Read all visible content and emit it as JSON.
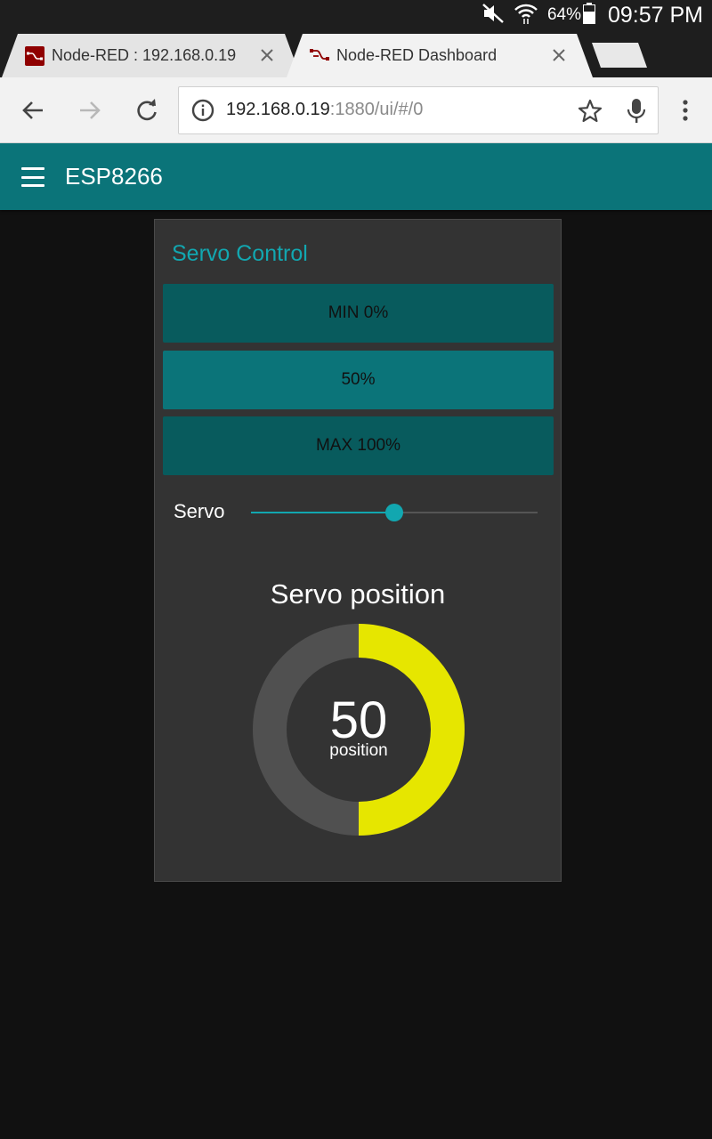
{
  "status_bar": {
    "battery_percent": "64%",
    "time": "09:57 PM",
    "icons": [
      "mute-icon",
      "wifi-icon",
      "battery-icon"
    ]
  },
  "tabs": [
    {
      "title": "Node-RED : 192.168.0.19",
      "active": false,
      "icon": "node-red-favicon"
    },
    {
      "title": "Node-RED Dashboard",
      "active": true,
      "icon": "node-red-favicon"
    }
  ],
  "toolbar": {
    "url_host": "192.168.0.19",
    "url_rest": ":1880/ui/#/0",
    "icons": [
      "back-arrow-icon",
      "forward-arrow-icon",
      "reload-icon",
      "info-icon",
      "star-icon",
      "mic-icon",
      "overflow-menu-icon"
    ]
  },
  "app": {
    "title": "ESP8266",
    "accent": "#0b7479"
  },
  "group": {
    "title": "Servo Control",
    "buttons": [
      {
        "label": "MIN 0%"
      },
      {
        "label": "50%"
      },
      {
        "label": "MAX 100%"
      }
    ],
    "slider": {
      "label": "Servo",
      "value_fraction": 0.5
    },
    "gauge": {
      "title": "Servo position",
      "value": "50",
      "units": "position",
      "fraction": 0.5,
      "fill_color": "#e6e600",
      "track_color": "#505050"
    }
  }
}
